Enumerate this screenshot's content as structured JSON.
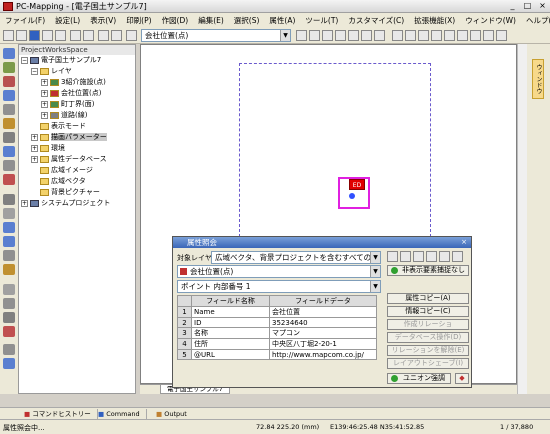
{
  "app": {
    "title": "PC-Mapping - [電子国土サンプル7]"
  },
  "menu": [
    "ファイル(F)",
    "設定(L)",
    "表示(V)",
    "印刷(P)",
    "作図(D)",
    "編集(E)",
    "選択(S)",
    "属性(A)",
    "ツール(T)",
    "カスタマイズ(C)",
    "拡張機能(X)",
    "ウィンドウ(W)",
    "ヘルプ(H)"
  ],
  "toolbar": {
    "layer_select": "会社位置(点)"
  },
  "workspace": {
    "header": "ProjectWorksSpace",
    "tree": [
      {
        "label": "電子国土サンプル7"
      },
      {
        "label": "レイヤ"
      },
      {
        "label": "3紹介施設(点)"
      },
      {
        "label": "会社位置(点)"
      },
      {
        "label": "町丁界(面)"
      },
      {
        "label": "道路(線)"
      },
      {
        "label": "表示モード"
      },
      {
        "label": "描画パラメーター"
      },
      {
        "label": "環境"
      },
      {
        "label": "属性データベース"
      },
      {
        "label": "広域イメージ"
      },
      {
        "label": "広域ベクタ"
      },
      {
        "label": "背景ピクチャー"
      },
      {
        "label": "システムプロジェクト"
      }
    ]
  },
  "right_panel": {
    "label": "ウィンドウ"
  },
  "map": {
    "tab_label": "電子国土サンプル7",
    "feature_label": "ED"
  },
  "dialog": {
    "title": "属性照会",
    "target_layer_label": "対象レイヤ",
    "target_layer_value": "広域ベクタ、背景プロジェクトを含むすべての表示レイヤ",
    "layer_value": "会社位置(点)",
    "hide_toggle": "非表示要素捕捉なし",
    "point_value": "ポイント 内部番号 1",
    "columns": [
      "フィールド名称",
      "フィールドデータ"
    ],
    "rows": [
      {
        "n": "1",
        "field": "Name",
        "value": "会社位置"
      },
      {
        "n": "2",
        "field": "ID",
        "value": "35234640"
      },
      {
        "n": "3",
        "field": "名称",
        "value": "マプコン"
      },
      {
        "n": "4",
        "field": "住所",
        "value": "中央区八丁堀2-20-1"
      },
      {
        "n": "5",
        "field": "@URL",
        "value": "http://www.mapcom.co.jp/"
      }
    ],
    "buttons": {
      "copy_attr": "属性コピー(A)",
      "copy_info": "情報コピー(C)",
      "b3": "作成リレーショ",
      "b4": "データベース操作(D)",
      "b5": "リレーションを解除(E)",
      "b6": "レイアウトシェーブ(I)",
      "union": "ユニオン強調"
    }
  },
  "bottom_tabs": [
    "コマンドヒストリー",
    "Command",
    "Output"
  ],
  "status": {
    "left": "属性照会中...",
    "coords": "72.84 225.20 (mm)",
    "latlon": "E139:46:25.48 N35:41:52.85",
    "scale": "1 / 37,880"
  }
}
